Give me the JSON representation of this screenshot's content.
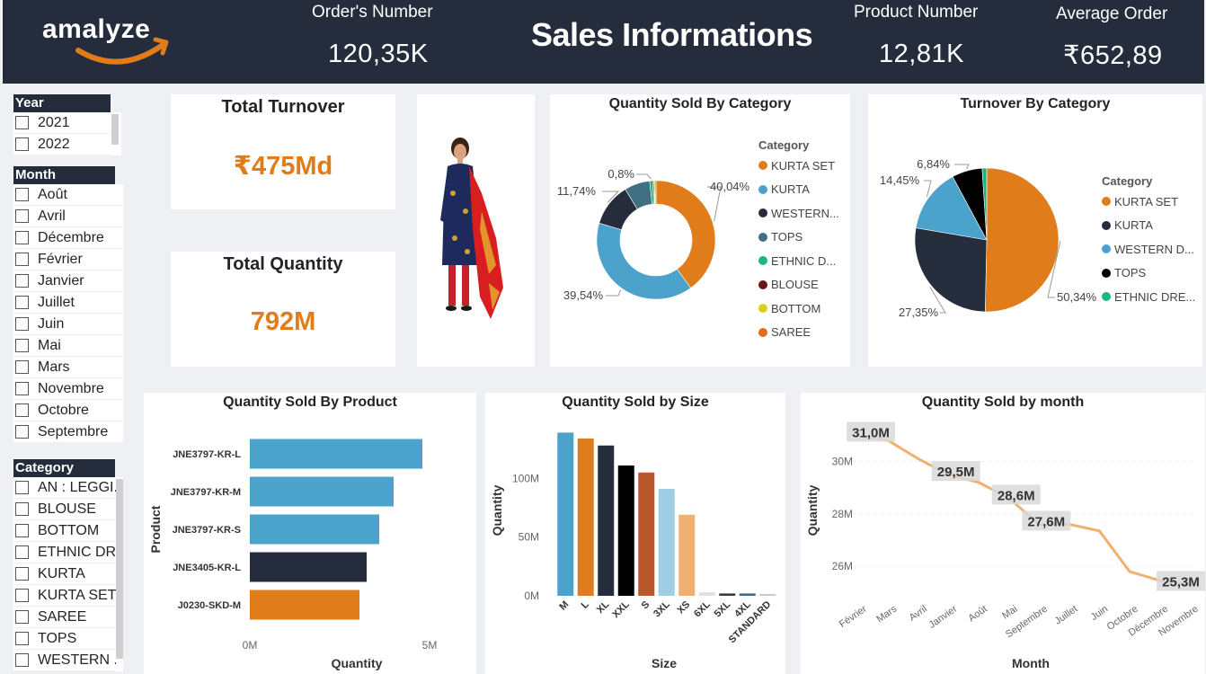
{
  "header": {
    "logo": "amalyze",
    "title": "Sales Informations",
    "kpis": [
      {
        "label": "Order's Number",
        "value": "120,35K"
      },
      {
        "label": "Product Number",
        "value": "12,81K"
      },
      {
        "label": "Average Order",
        "value": "₹652,89"
      }
    ]
  },
  "slicers": {
    "year": {
      "title": "Year",
      "items": [
        "2021",
        "2022"
      ]
    },
    "month": {
      "title": "Month",
      "items": [
        "Août",
        "Avril",
        "Décembre",
        "Février",
        "Janvier",
        "Juillet",
        "Juin",
        "Mai",
        "Mars",
        "Novembre",
        "Octobre",
        "Septembre"
      ]
    },
    "category": {
      "title": "Category",
      "items": [
        "AN : LEGGI...",
        "BLOUSE",
        "BOTTOM",
        "ETHNIC DR...",
        "KURTA",
        "KURTA SET",
        "SAREE",
        "TOPS",
        "WESTERN ..."
      ]
    }
  },
  "cards": {
    "turnover": {
      "title": "Total Turnover",
      "value": "₹475Md"
    },
    "quantity": {
      "title": "Total Quantity",
      "value": "792M"
    }
  },
  "colors": {
    "orange": "#e07c1a",
    "blue": "#4ba3cc",
    "navy": "#252d3c",
    "teal": "#3f6f80",
    "green": "#1db584",
    "maroon": "#6b1414",
    "yellow": "#d6d21f",
    "saree": "#e26a1a"
  },
  "chart_data": [
    {
      "id": "qty_by_category",
      "type": "pie",
      "variant": "donut",
      "title": "Quantity Sold By Category",
      "legend_title": "Category",
      "legend_position": "right",
      "legend": [
        "KURTA SET",
        "KURTA",
        "WESTERN...",
        "TOPS",
        "ETHNIC D...",
        "BLOUSE",
        "BOTTOM",
        "SAREE"
      ],
      "legend_colors": [
        "#e07c1a",
        "#4ba3cc",
        "#252d3c",
        "#3f6f80",
        "#1db584",
        "#6b1414",
        "#d6d21f",
        "#e26a1a"
      ],
      "slices": [
        {
          "label": "KURTA SET",
          "value": 40.04,
          "color": "#e07c1a",
          "text": "40,04%"
        },
        {
          "label": "KURTA",
          "value": 39.54,
          "color": "#4ba3cc",
          "text": "39,54%"
        },
        {
          "label": "WESTERN",
          "value": 11.74,
          "color": "#252d3c",
          "text": "11,74%"
        },
        {
          "label": "TOPS",
          "value": 6.96,
          "color": "#3f6f80",
          "text": ""
        },
        {
          "label": "ETHNIC",
          "value": 0.8,
          "color": "#1db584",
          "text": "0,8%"
        },
        {
          "label": "BLOUSE",
          "value": 0.32,
          "color": "#6b1414",
          "text": ""
        },
        {
          "label": "BOTTOM",
          "value": 0.3,
          "color": "#d6d21f",
          "text": ""
        },
        {
          "label": "SAREE",
          "value": 0.3,
          "color": "#e26a1a",
          "text": ""
        }
      ]
    },
    {
      "id": "turnover_by_category",
      "type": "pie",
      "title": "Turnover By Category",
      "legend_title": "Category",
      "legend_position": "right",
      "legend": [
        "KURTA SET",
        "KURTA",
        "WESTERN D...",
        "TOPS",
        "ETHNIC DRE..."
      ],
      "legend_colors": [
        "#e07c1a",
        "#252d3c",
        "#4ba3cc",
        "#000000",
        "#1db584"
      ],
      "slices": [
        {
          "label": "KURTA SET",
          "value": 50.34,
          "color": "#e07c1a",
          "text": "50,34%"
        },
        {
          "label": "KURTA",
          "value": 27.35,
          "color": "#252d3c",
          "text": "27,35%"
        },
        {
          "label": "WESTERN",
          "value": 14.45,
          "color": "#4ba3cc",
          "text": "14,45%"
        },
        {
          "label": "TOPS",
          "value": 6.84,
          "color": "#000000",
          "text": "6,84%"
        },
        {
          "label": "ETHNIC",
          "value": 1.02,
          "color": "#1db584",
          "text": ""
        }
      ]
    },
    {
      "id": "qty_by_product",
      "type": "bar",
      "orientation": "horizontal",
      "title": "Quantity Sold By Product",
      "xlabel": "Quantity",
      "ylabel": "Product",
      "categories": [
        "JNE3797-KR-L",
        "JNE3797-KR-M",
        "JNE3797-KR-S",
        "JNE3405-KR-L",
        "J0230-SKD-M"
      ],
      "values": [
        4.8,
        4.0,
        3.6,
        3.25,
        3.05
      ],
      "colors": [
        "#4ba3cc",
        "#4ba3cc",
        "#4ba3cc",
        "#252d3c",
        "#e07c1a"
      ],
      "xlim": [
        0,
        5
      ],
      "xticks": [
        "0M",
        "5M"
      ]
    },
    {
      "id": "qty_by_size",
      "type": "bar",
      "title": "Quantity Sold by Size",
      "xlabel": "Size",
      "ylabel": "Quantity",
      "categories": [
        "M",
        "L",
        "XL",
        "XXL",
        "S",
        "3XL",
        "XS",
        "6XL",
        "5XL",
        "4XL",
        "STANDARD"
      ],
      "values": [
        139,
        134,
        128,
        111,
        105,
        91,
        69,
        3,
        2,
        2,
        1.5
      ],
      "colors": [
        "#4ba3cc",
        "#e07c1a",
        "#252d3c",
        "#000000",
        "#b8582a",
        "#9fcde2",
        "#f0b070",
        "#e0e0e0",
        "#3a3a3a",
        "#3f6f80",
        "#c8c8c8"
      ],
      "ylim": [
        0,
        150
      ],
      "yticks": [
        {
          "v": 0,
          "t": "0M"
        },
        {
          "v": 50,
          "t": "50M"
        },
        {
          "v": 100,
          "t": "100M"
        }
      ]
    },
    {
      "id": "qty_by_month",
      "type": "line",
      "title": "Quantity Sold by month",
      "xlabel": "Month",
      "ylabel": "Quantity",
      "color": "#f0b070",
      "categories": [
        "Février",
        "Mars",
        "Avril",
        "Janvier",
        "Août",
        "Mai",
        "Septembre",
        "Juillet",
        "Juin",
        "Octobre",
        "Décembre",
        "Novembre"
      ],
      "values": [
        31.0,
        30.8,
        30.1,
        29.5,
        29.2,
        28.6,
        27.6,
        27.6,
        27.35,
        25.8,
        25.45,
        25.3
      ],
      "data_labels": [
        {
          "index": 0,
          "text": "31,0M"
        },
        {
          "index": 3,
          "text": "29,5M"
        },
        {
          "index": 5,
          "text": "28,6M"
        },
        {
          "index": 6,
          "text": "27,6M"
        },
        {
          "index": 11,
          "text": "25,3M"
        }
      ],
      "ylim": [
        24.8,
        31.6
      ],
      "yticks": [
        {
          "v": 26,
          "t": "26M"
        },
        {
          "v": 28,
          "t": "28M"
        },
        {
          "v": 30,
          "t": "30M"
        }
      ]
    }
  ]
}
